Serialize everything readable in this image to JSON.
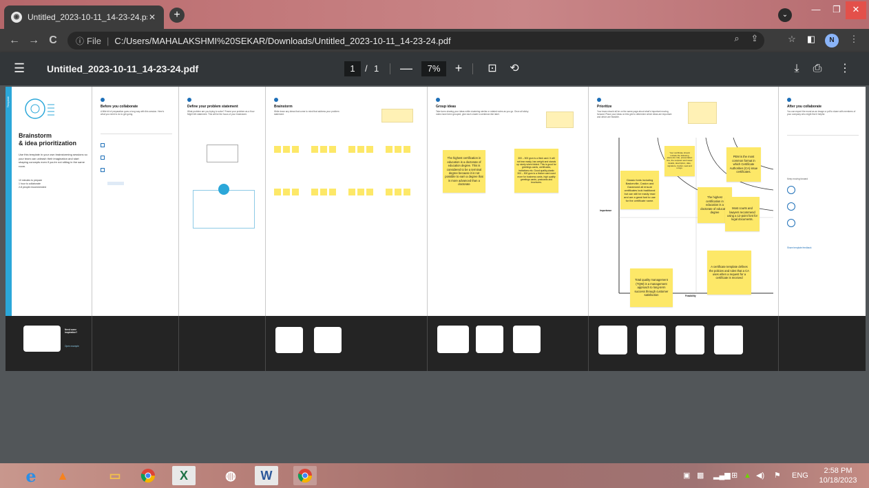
{
  "browser": {
    "tab_title": "Untitled_2023-10-11_14-23-24.pɔ",
    "url_scheme": "File",
    "url": "C:/Users/MAHALAKSHMI%20SEKAR/Downloads/Untitled_2023-10-11_14-23-24.pdf",
    "profile_initial": "N"
  },
  "pdf_toolbar": {
    "title": "Untitled_2023-10-11_14-23-24.pdf",
    "page_current": "1",
    "page_sep": "/",
    "page_total": "1",
    "zoom": "7%"
  },
  "board": {
    "stripe_label": "Template",
    "intro": {
      "title_line1": "Brainstorm",
      "title_line2": "& idea prioritization",
      "text": "Use this template in your own brainstorming sessions so your team can unleash their imagination and start shaping concepts even if you're not sitting in the same room.",
      "meta1": "10 minutes to prepare",
      "meta2": "1 hour to collaborate",
      "meta3": "2-8 people recommended"
    },
    "panels": [
      {
        "title": "Before you collaborate",
        "desc": "A little bit of preparation goes a long way with this session. Here's what you need to do to get going."
      },
      {
        "title": "Define your problem statement",
        "desc": "What problem are you trying to solve? Frame your problem as a How Might We statement. This will be the focus of your brainstorm."
      },
      {
        "title": "Brainstorm",
        "desc": "Write down any ideas that come to mind that address your problem statement."
      },
      {
        "title": "Group ideas",
        "desc": "Take turns sharing your ideas while clustering similar or related notes as you go. Once all sticky notes have been grouped, give each cluster a sentence-like label."
      },
      {
        "title": "Prioritize",
        "desc": "Your team should all be on the same page about what's important moving forward. Place your ideas on this grid to determine which ideas are important and which are feasible."
      },
      {
        "title": "After you collaborate",
        "desc": "You can export the mural as an image or pdf to share with members of your company who might find it helpful."
      }
    ],
    "group_notes": {
      "a": "The highest certification in education is a doctorate of education degree. This is considered to be a terminal degree because it is not possible to earn a degree that is more advanced than a doctorate",
      "b": "300 – 500 gsm is a thick card. It will not tear easily, has weight and stands up nicely when folded. This is good for greetings cards, certificates, invitations etc. Good quality plastic 300 – 500 gsm is a thicker card used more for business cards, high quality greetings cards, postcards and brochures."
    },
    "grid_notes": {
      "n1": "Classic fonts including Baskerville, Caslon and Garamond all ensure certificates look traditional but can still be easily read and are a great font to use for the certificate name.",
      "n2": "Your certificate should include the following elements: title, presentation line, the recipient and issuer details, description, date, signature, border, seal and a logo.",
      "n3": "PEM is the most common format in which Certificate Authorities (CA) issue certificates.",
      "n4": "The highest certification in education is a doctorate of education degree",
      "n5": "Most courts and lawyers recommend using a 12-point font for legal documents.",
      "n6": "Total quality management (TQM) is a management approach to long-term success through customer satisfaction",
      "n7": "A certificate template defines the policies and rules that a CA uses when a request for a certificate is received"
    },
    "grid_axes": {
      "y_label": "Importance",
      "x_label": "Feasibility"
    },
    "share_link": "Share template feedback",
    "tips_label": "Keep moving forward",
    "open_link": "Open example",
    "inspiration_title": "Need some inspiration?"
  },
  "taskbar": {
    "lang": "ENG",
    "time": "2:58 PM",
    "date": "10/18/2023"
  },
  "colors": {
    "accent_blue": "#2ba7d9",
    "sticky_yellow": "#fde868",
    "viewer_bg": "#525659",
    "pdf_toolbar_bg": "#323639"
  }
}
